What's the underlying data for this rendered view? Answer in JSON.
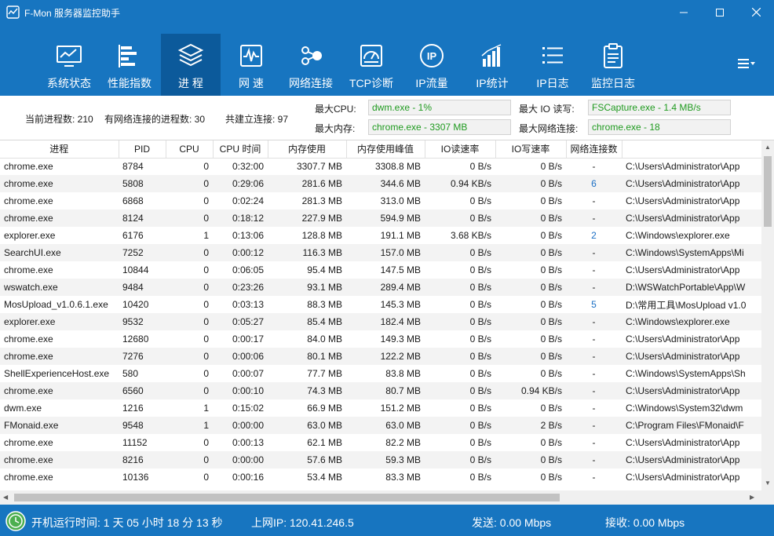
{
  "window": {
    "title": "F-Mon 服务器监控助手"
  },
  "toolbar": {
    "items": [
      {
        "label": "系统状态",
        "icon": "monitor-icon"
      },
      {
        "label": "性能指数",
        "icon": "bars-icon"
      },
      {
        "label": "进 程",
        "icon": "layers-icon"
      },
      {
        "label": "网 速",
        "icon": "waveform-icon"
      },
      {
        "label": "网络连接",
        "icon": "network-nodes-icon"
      },
      {
        "label": "TCP诊断",
        "icon": "tcp-diagnose-icon"
      },
      {
        "label": "IP流量",
        "icon": "ip-circle-icon"
      },
      {
        "label": "IP统计",
        "icon": "signal-bars-icon"
      },
      {
        "label": "IP日志",
        "icon": "list-icon"
      },
      {
        "label": "监控日志",
        "icon": "clipboard-icon"
      }
    ],
    "active_index": 2
  },
  "info": {
    "processes_label": "当前进程数: 210",
    "net_processes_label": "有网络连接的进程数: 30",
    "connections_label": "共建立连接: 97",
    "max_cpu_label": "最大CPU:",
    "max_cpu_value": "dwm.exe - 1%",
    "max_mem_label": "最大内存:",
    "max_mem_value": "chrome.exe - 3307 MB",
    "max_io_label": "最大 IO 读写:",
    "max_io_value": "FSCapture.exe - 1.4 MB/s",
    "max_conn_label": "最大网络连接:",
    "max_conn_value": "chrome.exe - 18"
  },
  "table": {
    "columns": [
      "进程",
      "PID",
      "CPU",
      "CPU 时间",
      "内存使用",
      "内存使用峰值",
      "IO读速率",
      "IO写速率",
      "网络连接数",
      ""
    ],
    "rows": [
      [
        "chrome.exe",
        "8784",
        "0",
        "0:32:00",
        "3307.7 MB",
        "3308.8 MB",
        "0 B/s",
        "0 B/s",
        "-",
        "C:\\Users\\Administrator\\App"
      ],
      [
        "chrome.exe",
        "5808",
        "0",
        "0:29:06",
        "281.6 MB",
        "344.6 MB",
        "0.94 KB/s",
        "0 B/s",
        "6",
        "C:\\Users\\Administrator\\App"
      ],
      [
        "chrome.exe",
        "6868",
        "0",
        "0:02:24",
        "281.3 MB",
        "313.0 MB",
        "0 B/s",
        "0 B/s",
        "-",
        "C:\\Users\\Administrator\\App"
      ],
      [
        "chrome.exe",
        "8124",
        "0",
        "0:18:12",
        "227.9 MB",
        "594.9 MB",
        "0 B/s",
        "0 B/s",
        "-",
        "C:\\Users\\Administrator\\App"
      ],
      [
        "explorer.exe",
        "6176",
        "1",
        "0:13:06",
        "128.8 MB",
        "191.1 MB",
        "3.68 KB/s",
        "0 B/s",
        "2",
        "C:\\Windows\\explorer.exe"
      ],
      [
        "SearchUI.exe",
        "7252",
        "0",
        "0:00:12",
        "116.3 MB",
        "157.0 MB",
        "0 B/s",
        "0 B/s",
        "-",
        "C:\\Windows\\SystemApps\\Mi"
      ],
      [
        "chrome.exe",
        "10844",
        "0",
        "0:06:05",
        "95.4 MB",
        "147.5 MB",
        "0 B/s",
        "0 B/s",
        "-",
        "C:\\Users\\Administrator\\App"
      ],
      [
        "wswatch.exe",
        "9484",
        "0",
        "0:23:26",
        "93.1 MB",
        "289.4 MB",
        "0 B/s",
        "0 B/s",
        "-",
        "D:\\WSWatchPortable\\App\\W"
      ],
      [
        "MosUpload_v1.0.6.1.exe",
        "10420",
        "0",
        "0:03:13",
        "88.3 MB",
        "145.3 MB",
        "0 B/s",
        "0 B/s",
        "5",
        "D:\\常用工具\\MosUpload v1.0"
      ],
      [
        "explorer.exe",
        "9532",
        "0",
        "0:05:27",
        "85.4 MB",
        "182.4 MB",
        "0 B/s",
        "0 B/s",
        "-",
        "C:\\Windows\\explorer.exe"
      ],
      [
        "chrome.exe",
        "12680",
        "0",
        "0:00:17",
        "84.0 MB",
        "149.3 MB",
        "0 B/s",
        "0 B/s",
        "-",
        "C:\\Users\\Administrator\\App"
      ],
      [
        "chrome.exe",
        "7276",
        "0",
        "0:00:06",
        "80.1 MB",
        "122.2 MB",
        "0 B/s",
        "0 B/s",
        "-",
        "C:\\Users\\Administrator\\App"
      ],
      [
        "ShellExperienceHost.exe",
        "580",
        "0",
        "0:00:07",
        "77.7 MB",
        "83.8 MB",
        "0 B/s",
        "0 B/s",
        "-",
        "C:\\Windows\\SystemApps\\Sh"
      ],
      [
        "chrome.exe",
        "6560",
        "0",
        "0:00:10",
        "74.3 MB",
        "80.7 MB",
        "0 B/s",
        "0.94 KB/s",
        "-",
        "C:\\Users\\Administrator\\App"
      ],
      [
        "dwm.exe",
        "1216",
        "1",
        "0:15:02",
        "66.9 MB",
        "151.2 MB",
        "0 B/s",
        "0 B/s",
        "-",
        "C:\\Windows\\System32\\dwm"
      ],
      [
        "FMonaid.exe",
        "9548",
        "1",
        "0:00:00",
        "63.0 MB",
        "63.0 MB",
        "0 B/s",
        "2 B/s",
        "-",
        "C:\\Program Files\\FMonaid\\F"
      ],
      [
        "chrome.exe",
        "11152",
        "0",
        "0:00:13",
        "62.1 MB",
        "82.2 MB",
        "0 B/s",
        "0 B/s",
        "-",
        "C:\\Users\\Administrator\\App"
      ],
      [
        "chrome.exe",
        "8216",
        "0",
        "0:00:00",
        "57.6 MB",
        "59.3 MB",
        "0 B/s",
        "0 B/s",
        "-",
        "C:\\Users\\Administrator\\App"
      ],
      [
        "chrome.exe",
        "10136",
        "0",
        "0:00:16",
        "53.4 MB",
        "83.3 MB",
        "0 B/s",
        "0 B/s",
        "-",
        "C:\\Users\\Administrator\\App"
      ]
    ]
  },
  "status": {
    "uptime": "开机运行时间:  1  天  05 小时 18 分 13 秒",
    "ip": "上网IP: 120.41.246.5",
    "send": "发送: 0.00 Mbps",
    "recv": "接收: 0.00 Mbps"
  },
  "colors": {
    "brand": "#1775c0",
    "active": "#0c5a9b",
    "value_green": "#1f9a1f",
    "link": "#1b6fc4"
  }
}
